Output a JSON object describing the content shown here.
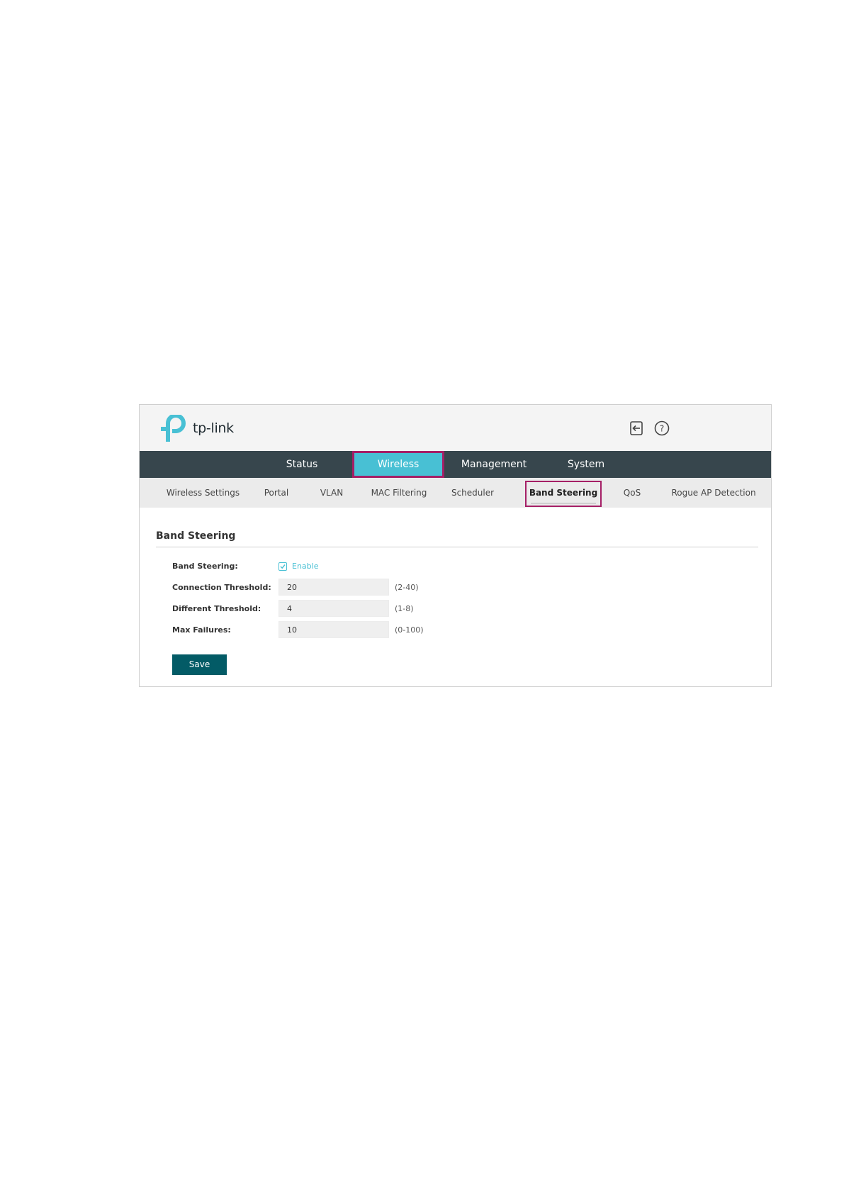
{
  "header": {
    "logo_text": "tp-link",
    "logout_icon": "logout-icon",
    "help_icon": "help-icon",
    "brand_color": "#48c0d4"
  },
  "main_nav": {
    "tabs": [
      {
        "label": "Status",
        "active": false
      },
      {
        "label": "Wireless",
        "active": true
      },
      {
        "label": "Management",
        "active": false
      },
      {
        "label": "System",
        "active": false
      }
    ]
  },
  "sub_nav": {
    "tabs": [
      {
        "label": "Wireless Settings",
        "active": false
      },
      {
        "label": "Portal",
        "active": false
      },
      {
        "label": "VLAN",
        "active": false
      },
      {
        "label": "MAC Filtering",
        "active": false
      },
      {
        "label": "Scheduler",
        "active": false
      },
      {
        "label": "Band Steering",
        "active": true
      },
      {
        "label": "QoS",
        "active": false
      },
      {
        "label": "Rogue AP Detection",
        "active": false
      }
    ]
  },
  "section": {
    "title": "Band Steering",
    "band_steering": {
      "label": "Band Steering:",
      "checked": true,
      "checkbox_label": "Enable"
    },
    "connection_threshold": {
      "label": "Connection Threshold:",
      "value": "20",
      "range": "(2-40)"
    },
    "different_threshold": {
      "label": "Different Threshold:",
      "value": "4",
      "range": "(1-8)"
    },
    "max_failures": {
      "label": "Max Failures:",
      "value": "10",
      "range": "(0-100)"
    },
    "save_label": "Save"
  },
  "colors": {
    "nav_bg": "#37464d",
    "active_tab_bg": "#48c0d4",
    "highlight_border": "#a51f66",
    "save_button": "#035b66"
  }
}
